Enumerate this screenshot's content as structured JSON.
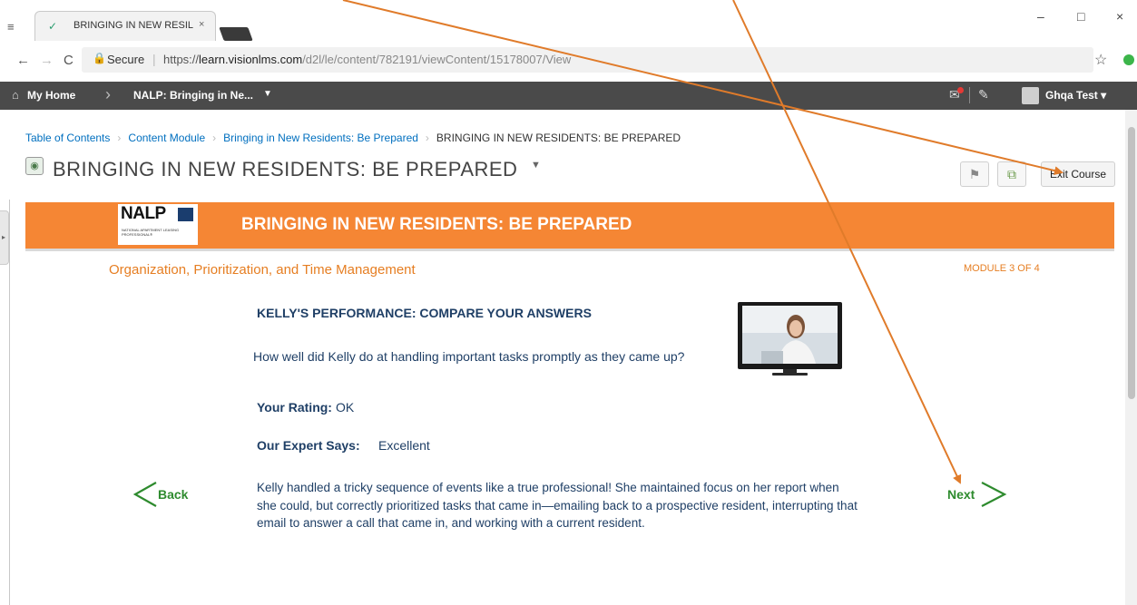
{
  "browser": {
    "tab_title": "BRINGING IN NEW RESIL",
    "tab_close": "×",
    "window_minimize": "–",
    "window_maximize": "□",
    "window_close": "×",
    "secure_label": "Secure",
    "url_scheme": "https://",
    "url_host": "learn.visionlms.com",
    "url_path": "/d2l/le/content/782191/viewContent/15178007/View"
  },
  "navbar": {
    "home_label": "My Home",
    "course_label": "NALP: Bringing in Ne...",
    "user_name": "Ghqa Test"
  },
  "breadcrumbs": [
    "Table of Contents",
    "Content Module",
    "Bringing in New Residents: Be Prepared",
    "BRINGING IN NEW RESIDENTS: BE PREPARED"
  ],
  "page": {
    "title": "BRINGING IN NEW RESIDENTS: BE PREPARED",
    "exit_label": "Exit Course"
  },
  "course": {
    "logo_text": "NALP",
    "logo_subtext": "NATIONAL APARTMENT LEASING PROFESSIONAL®",
    "banner_title": "BRINGING IN NEW RESIDENTS: BE PREPARED",
    "section_title": "Organization, Prioritization, and Time Management",
    "module_label": "MODULE 3 OF 4",
    "question_heading": "KELLY'S PERFORMANCE: COMPARE YOUR ANSWERS",
    "question_text": "How well did Kelly do at handling important tasks promptly as they came up?",
    "rating_label": "Your Rating:",
    "rating_value": "OK",
    "expert_label": "Our Expert Says:",
    "expert_value": "Excellent",
    "feedback": "Kelly handled a tricky sequence of events like a true professional!  She maintained focus on her report when she could, but correctly prioritized tasks that came in—emailing back to a prospective resident, interrupting that email to answer a call that came in, and working with a current resident.",
    "back_label": "Back",
    "next_label": "Next"
  },
  "colors": {
    "banner": "#f58634",
    "accent_orange": "#e67e22",
    "text_navy": "#1f3f66",
    "nav_green": "#2e8b2e",
    "annotation_arrow": "#e07b2a"
  }
}
